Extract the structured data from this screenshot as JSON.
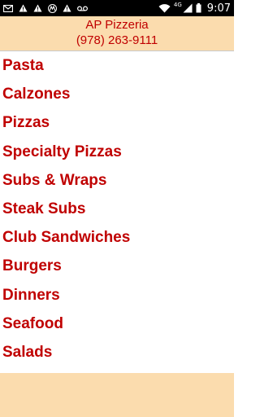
{
  "status_bar": {
    "network": "4G",
    "time": "9:07",
    "left_icons": [
      "mail-icon",
      "warning-icon",
      "warning-icon",
      "motorola-icon",
      "warning-icon",
      "voicemail-icon"
    ],
    "right_icons": [
      "wifi-icon",
      "cell-signal-icon",
      "battery-icon"
    ]
  },
  "header": {
    "title": "AP Pizzeria",
    "phone": "(978) 263-9111"
  },
  "menu": [
    {
      "label": "Pasta"
    },
    {
      "label": "Calzones"
    },
    {
      "label": "Pizzas"
    },
    {
      "label": "Specialty Pizzas"
    },
    {
      "label": "Subs & Wraps"
    },
    {
      "label": "Steak Subs"
    },
    {
      "label": "Club Sandwiches"
    },
    {
      "label": "Burgers"
    },
    {
      "label": "Dinners"
    },
    {
      "label": "Seafood"
    },
    {
      "label": "Salads"
    }
  ],
  "colors": {
    "accent": "#c00000",
    "header_background": "#fbdcae",
    "status_bar": "#000000"
  }
}
